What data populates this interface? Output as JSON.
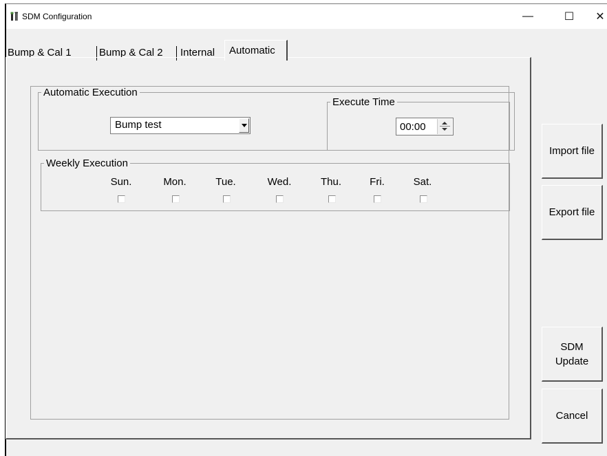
{
  "window": {
    "title": "SDM Configuration",
    "controls": {
      "minimize": "—",
      "maximize": "☐",
      "close": "✕"
    }
  },
  "tabs": [
    {
      "label": "Bump & Cal 1"
    },
    {
      "label": "Bump & Cal 2"
    },
    {
      "label": "Internal"
    },
    {
      "label": "Automatic"
    }
  ],
  "active_tab": "Automatic",
  "automatic": {
    "group_label": "Automatic Execution",
    "mode_value": "Bump test",
    "execute_time": {
      "label": "Execute Time",
      "value": "00:00"
    },
    "weekly": {
      "label": "Weekly Execution",
      "days": [
        {
          "label": "Sun.",
          "checked": false
        },
        {
          "label": "Mon.",
          "checked": false
        },
        {
          "label": "Tue.",
          "checked": false
        },
        {
          "label": "Wed.",
          "checked": false
        },
        {
          "label": "Thu.",
          "checked": false
        },
        {
          "label": "Fri.",
          "checked": false
        },
        {
          "label": "Sat.",
          "checked": false
        }
      ]
    }
  },
  "buttons": {
    "import_file": "Import file",
    "export_file": "Export file",
    "sdm_update": "SDM Update",
    "cancel": "Cancel"
  },
  "icons": {
    "app": "instrument-icon",
    "dropdown": "chevron-down-icon",
    "spin_up": "arrow-up-icon",
    "spin_down": "arrow-down-icon"
  }
}
